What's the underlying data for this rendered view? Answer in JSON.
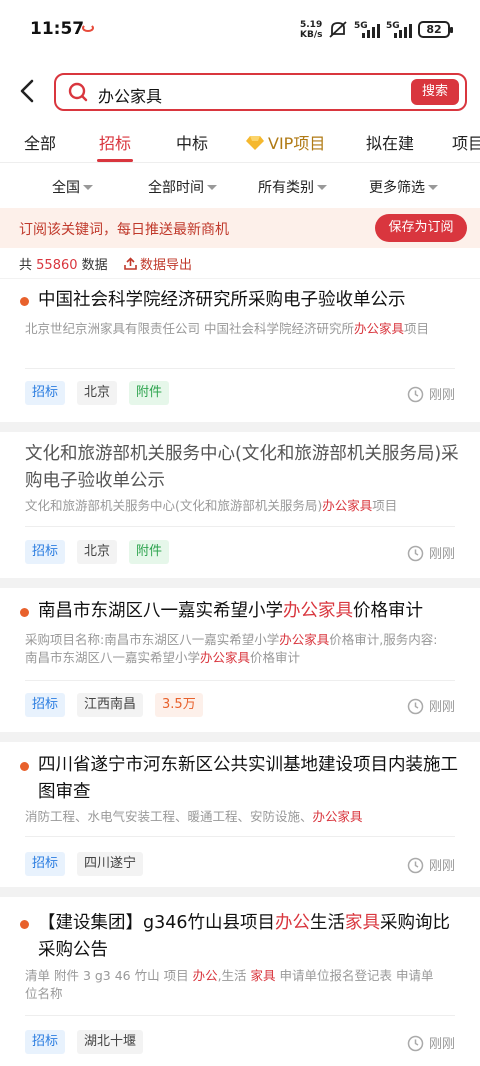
{
  "status": {
    "time": "11:57",
    "speed_value": "5.19",
    "speed_unit": "KB/s",
    "sig1": "5G",
    "sig2": "5G",
    "battery": "82"
  },
  "search": {
    "query": "办公家具",
    "button": "搜索"
  },
  "tabs": [
    "全部",
    "招标",
    "中标",
    "VIP项目",
    "拟在建",
    "项目"
  ],
  "active_tab": "招标",
  "filters": [
    "全国",
    "全部时间",
    "所有类别",
    "更多筛选"
  ],
  "subscribe": {
    "text": "订阅该关键词，每日推送最新商机",
    "button": "保存为订阅"
  },
  "summary": {
    "prefix": "共",
    "count": "55860",
    "suffix": "数据",
    "export": "数据导出"
  },
  "results": [
    {
      "title": "中国社会科学院经济研究所采购电子验收单公示",
      "desc_a": "北京世纪京洲家具有限责任公司 中国社会科学院经济研究所",
      "desc_hl": "办公家具",
      "desc_b": "项目",
      "type": "招标",
      "region": "北京",
      "extra": "附件",
      "time": "刚刚"
    },
    {
      "title": "文化和旅游部机关服务中心(文化和旅游部机关服务局)采购电子验收单公示",
      "desc_a": "文化和旅游部机关服务中心(文化和旅游部机关服务局)",
      "desc_hl": "办公家具",
      "desc_b": "项目",
      "type": "招标",
      "region": "北京",
      "extra": "附件",
      "time": "刚刚"
    },
    {
      "title_a": "南昌市东湖区八一嘉实希望小学",
      "title_hl": "办公家具",
      "title_b": "价格审计",
      "desc_a": "采购项目名称:南昌市东湖区八一嘉实希望小学",
      "desc_hl": "办公家具",
      "desc_b": "价格审计,服务内容:南昌市东湖区八一嘉实希望小学",
      "desc_hl2": "办公家具",
      "desc_c": "价格审计",
      "type": "招标",
      "region": "江西南昌",
      "money": "3.5万",
      "time": "刚刚"
    },
    {
      "title": "四川省遂宁市河东新区公共实训基地建设项目内装施工图审查",
      "desc_a": "消防工程、水电气安装工程、暖通工程、安防设施、",
      "desc_hl": "办公家具",
      "type": "招标",
      "region": "四川遂宁",
      "time": "刚刚"
    },
    {
      "title_a": "【建设集团】g346竹山县项目",
      "title_hl": "办公",
      "title_b": "生活",
      "title_hl2": "家具",
      "title_c": "采购询比采购公告",
      "desc_a": "清单 附件 3 g3 46 竹山 项目 ",
      "desc_hl": "办公",
      "desc_b": ",生活 ",
      "desc_hl2": "家具",
      "desc_c": " 申请单位报名登记表 申请单位名称",
      "type": "招标",
      "region": "湖北十堰",
      "time": "刚刚"
    }
  ],
  "colors": {
    "accent": "#d9363e",
    "dot": "#e8612c",
    "type_tag": "#2b7de0",
    "attach_tag": "#2ea44f"
  }
}
